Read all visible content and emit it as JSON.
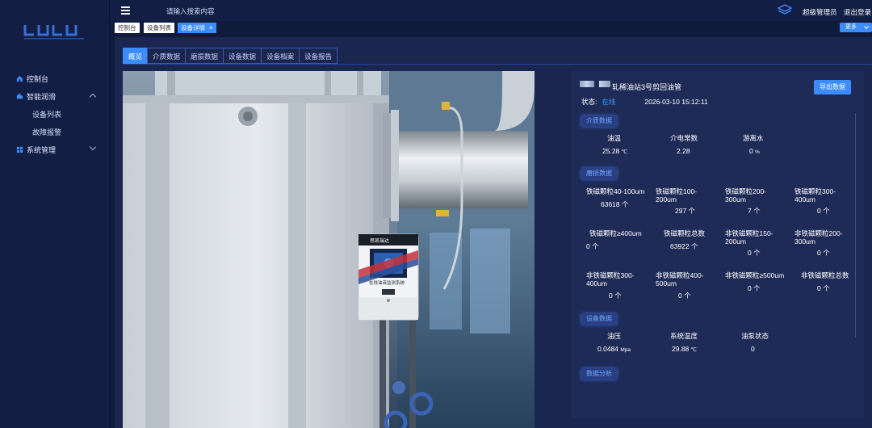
{
  "header": {
    "search_placeholder": "请输入搜索内容",
    "user": "超级管理员",
    "logout": "退出登录"
  },
  "sidebar": {
    "items": [
      {
        "label": "控制台"
      },
      {
        "label": "智能润滑"
      },
      {
        "label": "设备列表"
      },
      {
        "label": "故障报警"
      },
      {
        "label": "系统管理"
      }
    ]
  },
  "tagbar": {
    "tags": [
      "控制台",
      "设备列表",
      "设备详情"
    ],
    "close": "×",
    "more": "更多"
  },
  "tabs": [
    "概览",
    "介质数据",
    "磨损数据",
    "设备数据",
    "设备档案",
    "设备报告"
  ],
  "device": {
    "name": "轧稀油站3号剪回油管",
    "export": "导出数据",
    "status_label": "状态:",
    "status_value": "在线",
    "timestamp": "2026-03-10 15:12:11"
  },
  "sections": {
    "medium": "介质数据",
    "wear": "磨损数据",
    "equipment": "设备数据",
    "analysis": "数据分析"
  },
  "medium": [
    {
      "label": "油温",
      "value": "25.28",
      "unit": "℃"
    },
    {
      "label": "介电常数",
      "value": "2.28",
      "unit": ""
    },
    {
      "label": "游离水",
      "value": "0",
      "unit": "%"
    }
  ],
  "wear": [
    {
      "label": "铁磁颗粒40-100um",
      "value": "63618 个"
    },
    {
      "label": "铁磁颗粒100-200um",
      "value": "297 个"
    },
    {
      "label": "铁磁颗粒200-300um",
      "value": "7 个"
    },
    {
      "label": "铁磁颗粒300-400um",
      "value": "0 个"
    },
    {
      "label": "铁磁颗粒≥400um",
      "value": "0 个"
    },
    {
      "label": "铁磁颗粒总数",
      "value": "63922 个"
    },
    {
      "label": "非铁磁颗粒150-200um",
      "value": "0 个"
    },
    {
      "label": "非铁磁颗粒200-300um",
      "value": "0 个"
    },
    {
      "label": "非铁磁颗粒300-400um",
      "value": "0 个"
    },
    {
      "label": "非铁磁颗粒400-500um",
      "value": "0 个"
    },
    {
      "label": "非铁磁颗粒≥500um",
      "value": "0 个"
    },
    {
      "label": "非铁磁颗粒总数",
      "value": "0 个"
    }
  ],
  "equipment": [
    {
      "label": "油压",
      "value": "0.0484",
      "unit": "Mpa"
    },
    {
      "label": "系统温度",
      "value": "29.88",
      "unit": "℃"
    },
    {
      "label": "油泵状态",
      "value": "0",
      "unit": ""
    }
  ],
  "monitor": {
    "brand": "思凯瑞达",
    "caption": "在线油液监测系统"
  },
  "colors": {
    "accent": "#3c8cff",
    "online": "#3c9cff",
    "background": "#101a3b",
    "panel": "#1f2b57"
  }
}
